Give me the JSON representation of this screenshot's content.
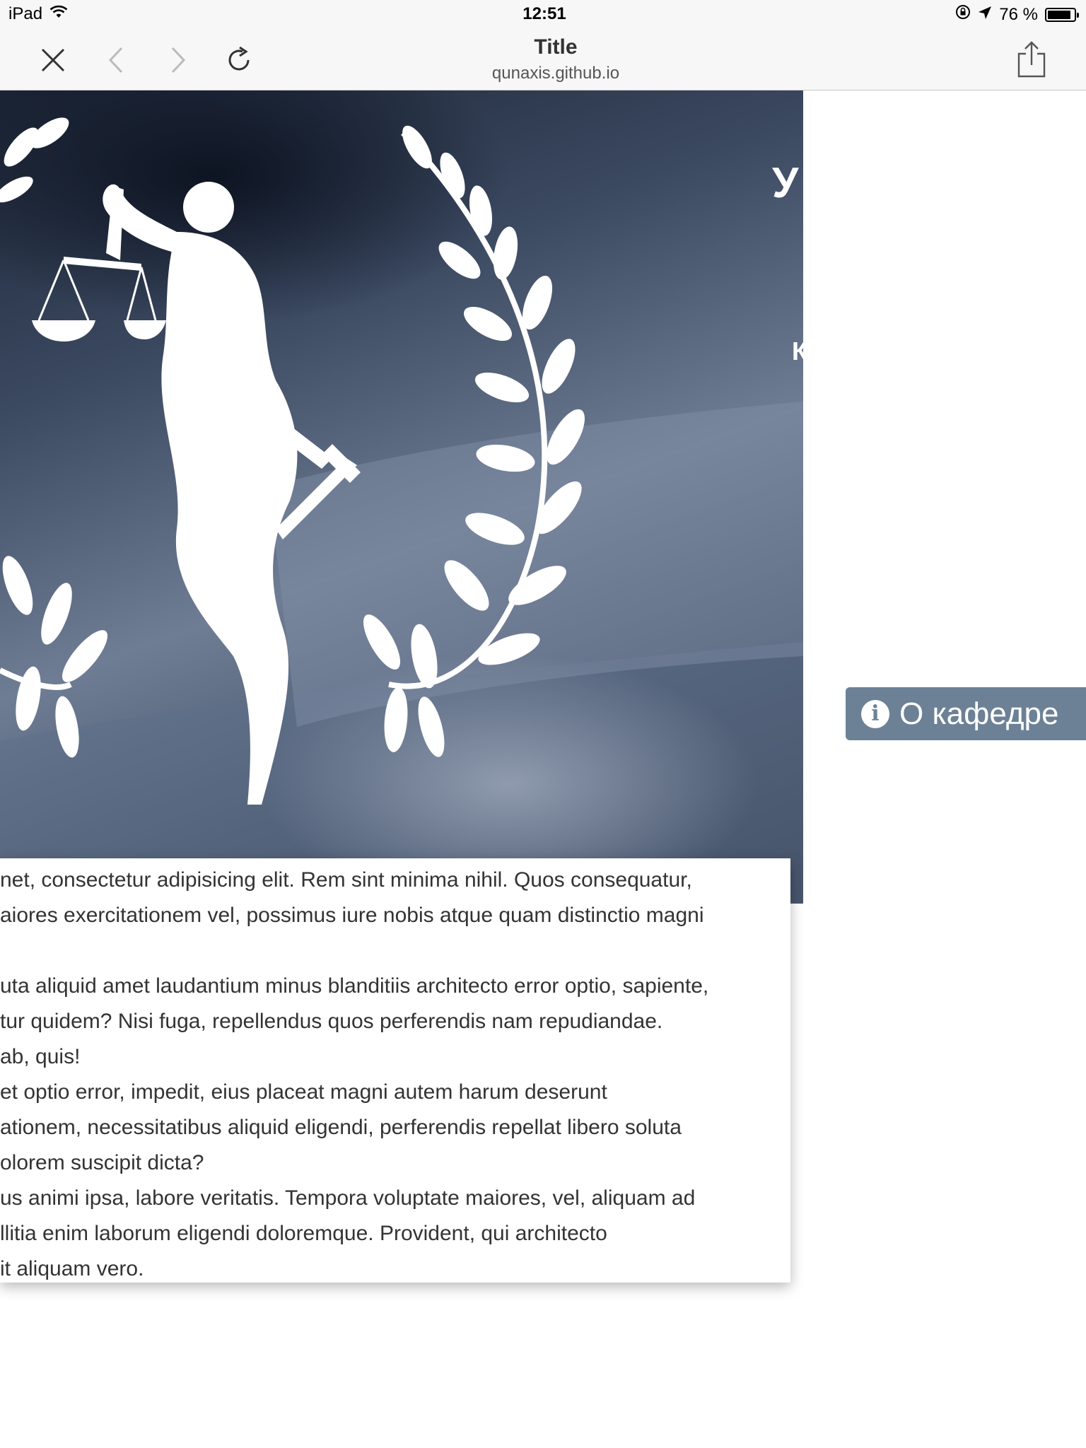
{
  "status_bar": {
    "device": "iPad",
    "time": "12:51",
    "battery": "76 %",
    "battery_level_fraction": 0.76,
    "icons": [
      "wifi-icon",
      "orientation-lock-icon",
      "location-arrow-icon",
      "battery-icon"
    ]
  },
  "browser": {
    "title": "Title",
    "url": "qunaxis.github.io",
    "icons": [
      "close-icon",
      "back-chevron-icon",
      "forward-chevron-icon",
      "reload-icon",
      "share-icon"
    ]
  },
  "hero": {
    "partial_text_1": "У",
    "partial_text_2": "К",
    "image_subject": "justice-laurel-emblem"
  },
  "content": {
    "lines": [
      "net, consectetur adipisicing elit. Rem sint minima nihil. Quos consequatur,",
      "aiores exercitationem vel, possimus iure nobis atque quam distinctio magni",
      "",
      "uta aliquid amet laudantium minus blanditiis architecto error optio, sapiente,",
      "tur quidem? Nisi fuga, repellendus quos perferendis nam repudiandae.",
      "ab, quis!",
      "et optio error, impedit, eius placeat magni autem harum deserunt",
      "ationem, necessitatibus aliquid eligendi, perferendis repellat libero soluta",
      "olorem suscipit dicta?",
      "us animi ipsa, labore veritatis. Tempora voluptate maiores, vel, aliquam ad",
      "llitia enim laborum eligendi doloremque. Provident, qui architecto",
      "it aliquam vero."
    ]
  },
  "about_button": {
    "label": "О кафедре",
    "icon": "info-icon"
  },
  "colors": {
    "toolbar_bg": "#f7f7f7",
    "about_button_bg": "#6c8196",
    "hero_dark": "#1b2434"
  }
}
